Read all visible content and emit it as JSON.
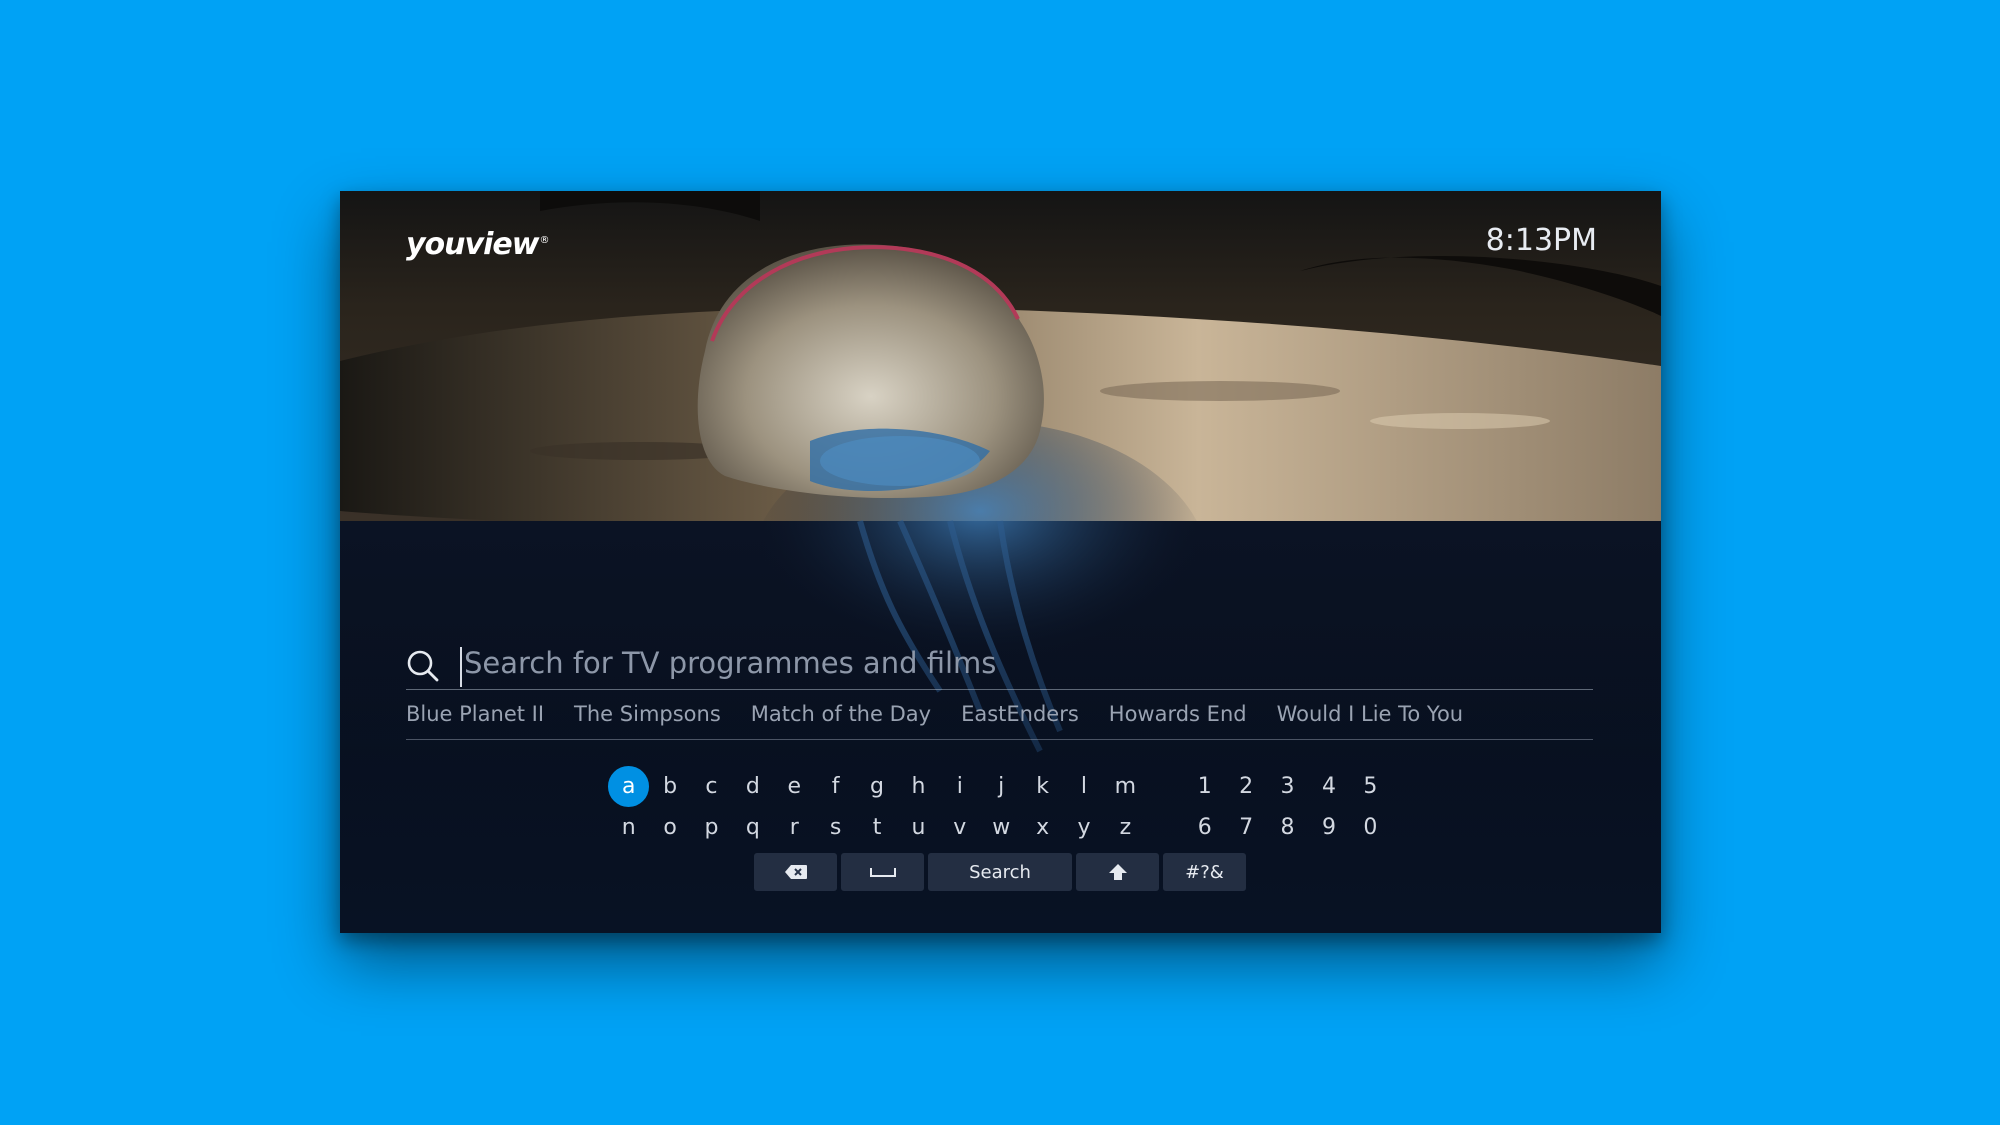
{
  "header": {
    "logo_text": "youview",
    "logo_mark": "®",
    "clock": "8:13PM"
  },
  "search": {
    "placeholder": "Search for TV programmes and films",
    "value": "",
    "icon": "search-icon"
  },
  "suggestions": [
    "Blue Planet II",
    "The Simpsons",
    "Match of the Day",
    "EastEnders",
    "Howards End",
    "Would I Lie To You"
  ],
  "keyboard": {
    "row1": [
      "a",
      "b",
      "c",
      "d",
      "e",
      "f",
      "g",
      "h",
      "i",
      "j",
      "k",
      "l",
      "m"
    ],
    "row1_digits": [
      "1",
      "2",
      "3",
      "4",
      "5"
    ],
    "row2": [
      "n",
      "o",
      "p",
      "q",
      "r",
      "s",
      "t",
      "u",
      "v",
      "w",
      "x",
      "y",
      "z"
    ],
    "row2_digits": [
      "6",
      "7",
      "8",
      "9",
      "0"
    ],
    "selected_key": "a",
    "functions": {
      "backspace_icon": "backspace-icon",
      "space_icon": "space-icon",
      "search_label": "Search",
      "shift_icon": "shift-icon",
      "symbols_label": "#?&"
    }
  },
  "colors": {
    "page_background": "#00a2f5",
    "accent": "#0090e3"
  }
}
